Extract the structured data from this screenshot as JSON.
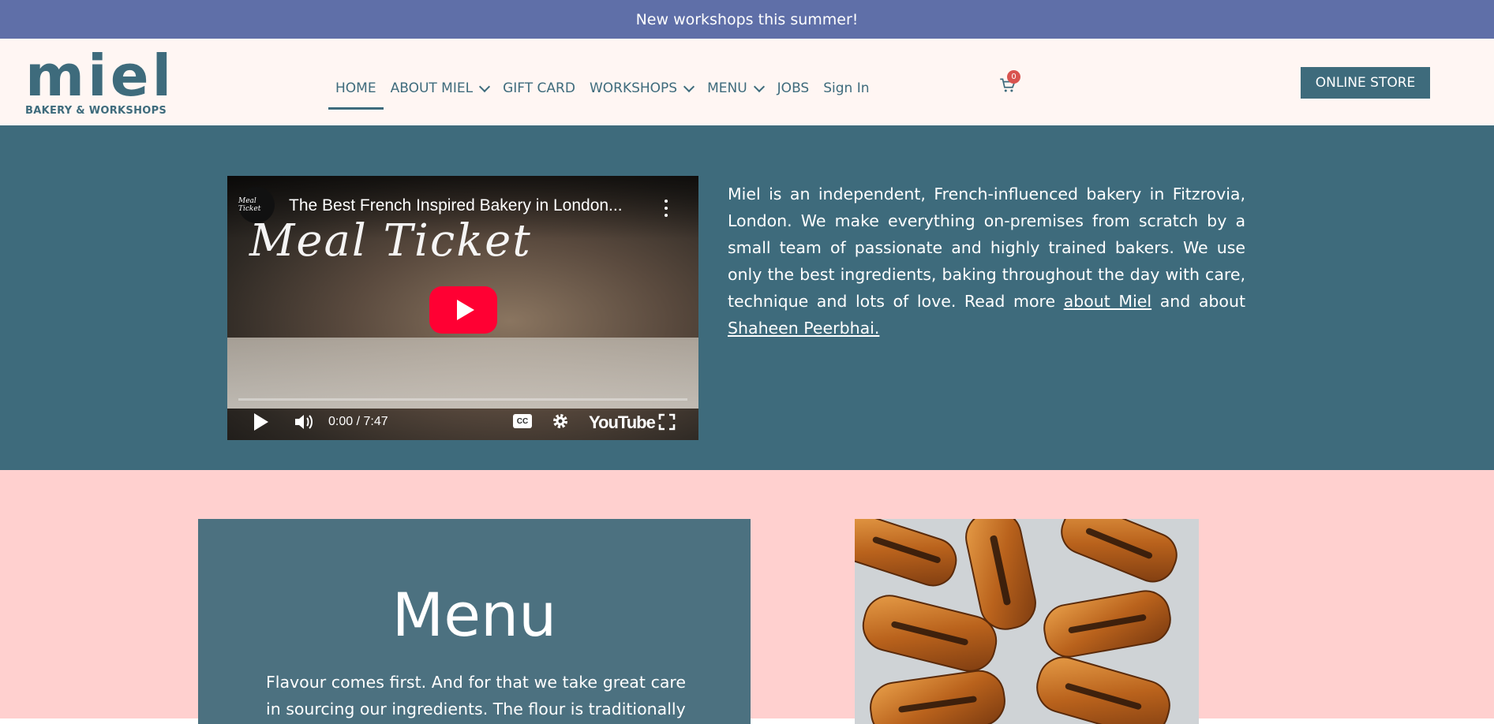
{
  "announcement": {
    "text": "New workshops this summer!",
    "background": "#5f6fa8"
  },
  "header": {
    "logo": {
      "wordmark": "miel",
      "tagline": "BAKERY & WORKSHOPS"
    },
    "nav": {
      "items": [
        {
          "label": "HOME",
          "active": true,
          "has_dropdown": false
        },
        {
          "label": "ABOUT MIEL",
          "active": false,
          "has_dropdown": true
        },
        {
          "label": "GIFT CARD",
          "active": false,
          "has_dropdown": false
        },
        {
          "label": "WORKSHOPS",
          "active": false,
          "has_dropdown": true
        },
        {
          "label": "MENU",
          "active": false,
          "has_dropdown": true
        },
        {
          "label": "JOBS",
          "active": false,
          "has_dropdown": false
        },
        {
          "label": "Sign In",
          "active": false,
          "has_dropdown": false
        }
      ]
    },
    "cart": {
      "icon": "cart-icon",
      "count": "0"
    },
    "store_button": "ONLINE STORE"
  },
  "hero": {
    "video": {
      "title": "The Best French Inspired Bakery in London...",
      "overlay_script": "Meal Ticket",
      "channel_avatar_text": "Meal Ticket",
      "time": "0:00 / 7:47",
      "brand": "YouTube",
      "cc": "CC"
    },
    "paragraph_before": "Miel is an independent, French-influenced bakery in Fitzrovia, London. We make everything on-premises from scratch by a small team of passionate and highly trained bakers. We use only the best ingredients, baking throughout the day with care, technique and lots of love. Read more ",
    "link_about": "about Miel",
    "paragraph_mid": " and about ",
    "link_shaheen": "Shaheen Peerbhai."
  },
  "menu_section": {
    "title": "Menu",
    "description": "Flavour comes first. And for that we take great care in sourcing our ingredients. The flour is traditionally"
  },
  "colors": {
    "brand_teal": "#3e6b7c",
    "header_bg": "#fff6f3",
    "pink_section": "#ffd0cf",
    "menu_card": "#4c7180",
    "cart_badge": "#d9534f",
    "youtube_red": "#ff0033"
  }
}
